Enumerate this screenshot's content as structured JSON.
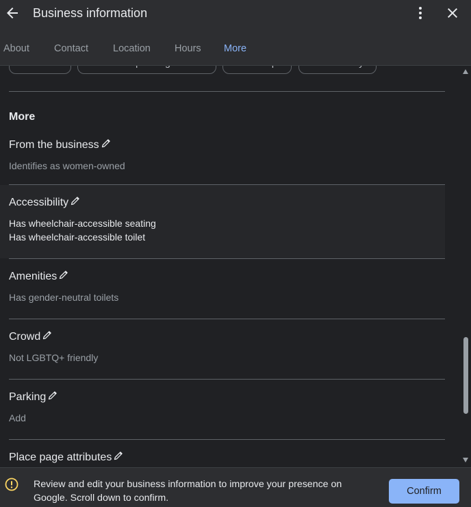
{
  "header": {
    "title": "Business information"
  },
  "tabs": [
    {
      "label": "About"
    },
    {
      "label": "Contact"
    },
    {
      "label": "Location"
    },
    {
      "label": "Hours"
    },
    {
      "label": "More"
    }
  ],
  "chips": [
    {
      "label": "Lunch"
    },
    {
      "label": "Online operating hours"
    },
    {
      "label": "Pick-up"
    },
    {
      "label": "Takeaway"
    }
  ],
  "section": {
    "title": "More"
  },
  "attributes": [
    {
      "title": "From the business",
      "lines": [
        "Identifies as women-owned"
      ]
    },
    {
      "title": "Accessibility",
      "lines": [
        "Has wheelchair-accessible seating",
        "Has wheelchair-accessible toilet"
      ]
    },
    {
      "title": "Amenities",
      "lines": [
        "Has gender-neutral toilets"
      ]
    },
    {
      "title": "Crowd",
      "lines": [
        "Not LGBTQ+ friendly"
      ]
    },
    {
      "title": "Parking",
      "lines": [
        "Add"
      ]
    },
    {
      "title": "Place page attributes",
      "lines": []
    }
  ],
  "footer": {
    "message": "Review and edit your business information to improve your presence on Google. Scroll down to confirm.",
    "confirm_label": "Confirm"
  },
  "icons": {
    "back": "back-arrow-icon",
    "more": "more-vert-icon",
    "close": "close-icon",
    "edit": "pencil-icon",
    "warning": "warning-icon"
  },
  "colors": {
    "accent": "#8ab4f8",
    "warning": "#fdd663",
    "background": "#202124"
  }
}
